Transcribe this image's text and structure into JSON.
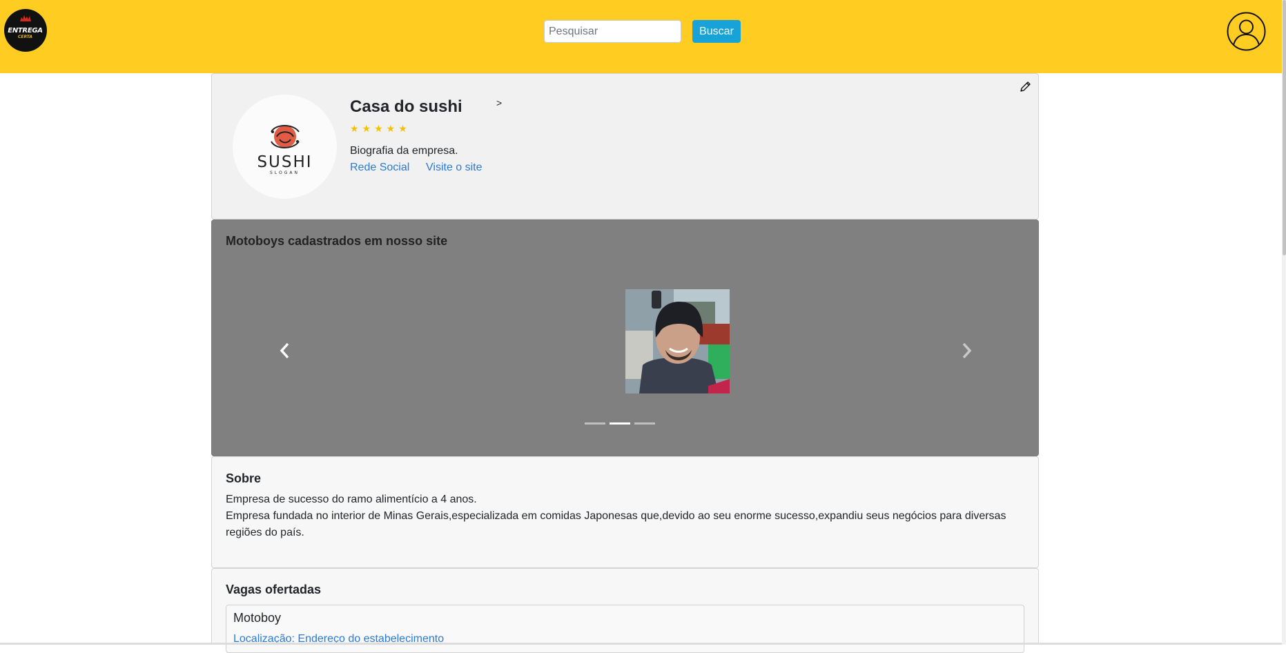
{
  "header": {
    "logo_text_main": "ENTREGA",
    "logo_text_sub": "CERTA",
    "search_placeholder": "Pesquisar",
    "search_button": "Buscar"
  },
  "profile": {
    "logo_text": "SUSHI",
    "logo_slogan": "SLOGAN",
    "company_name": "Casa do sushi",
    "arrow": ">",
    "stars": "★★★★★",
    "rating": 5,
    "bio": "Biografia da empresa.",
    "link_social": "Rede Social",
    "link_site": "Visite o site"
  },
  "carousel": {
    "title": "Motoboys cadastrados em nosso site",
    "slide_count": 3,
    "active_slide": 2
  },
  "about": {
    "title": "Sobre",
    "line1": "Empresa de sucesso do ramo alimentício a 4 anos.",
    "line2": "Empresa fundada no interior de Minas Gerais,especializada em comidas Japonesas que,devido ao seu enorme sucesso,expandiu seus negócios para diversas regiões do país."
  },
  "jobs": {
    "title": "Vagas ofertadas",
    "items": [
      {
        "title": "Motoboy",
        "location": "Localização: Endereço do estabelecimento"
      }
    ]
  },
  "colors": {
    "header_bg": "#ffcc22",
    "button_bg": "#17a2d8",
    "link": "#2a7ad6",
    "star": "#f2c200",
    "carousel_bg": "#808080"
  }
}
